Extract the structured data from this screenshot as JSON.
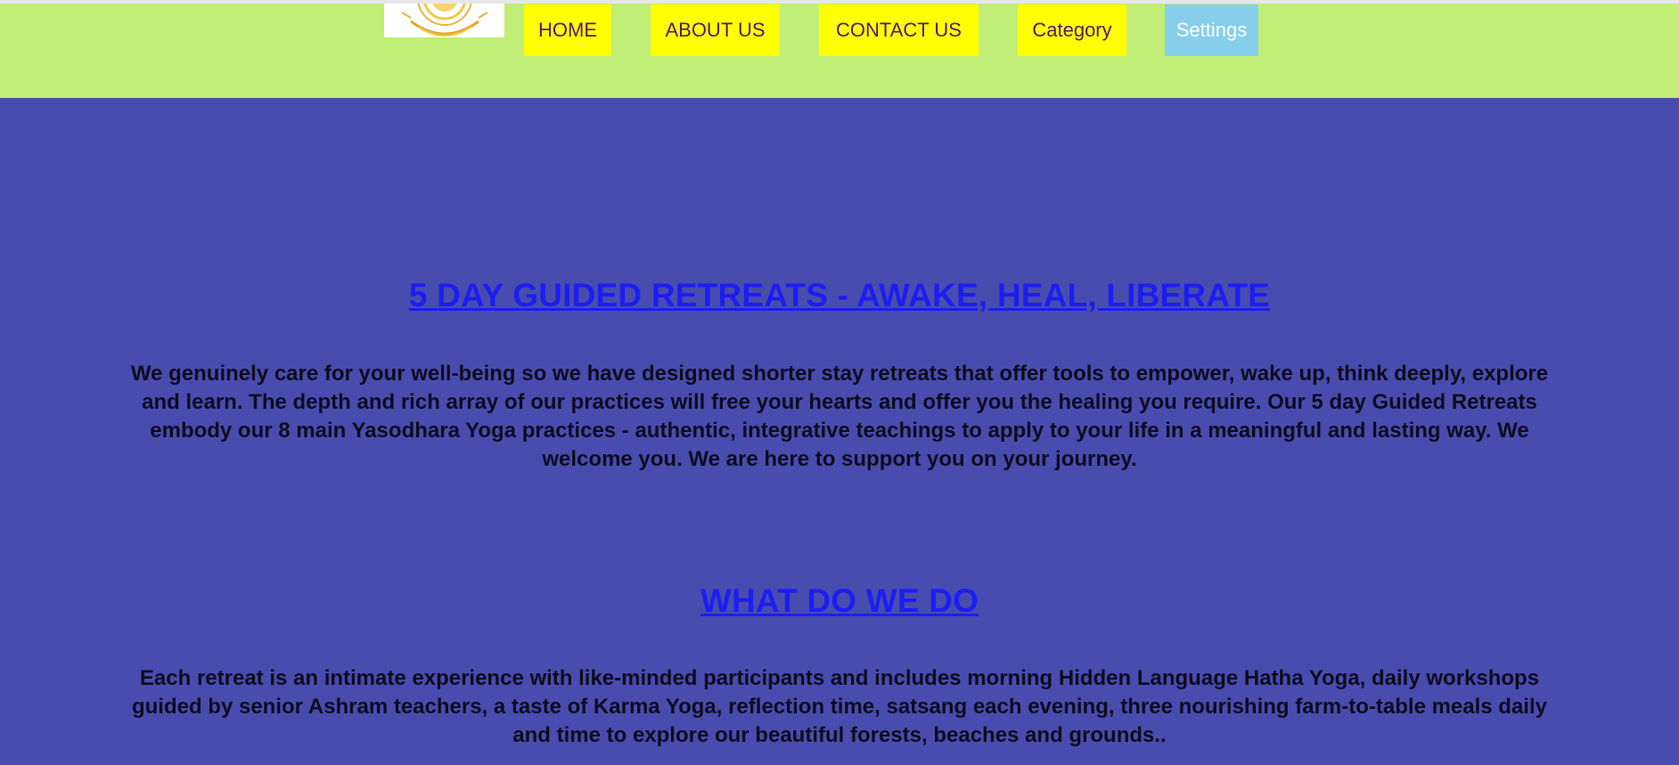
{
  "header": {
    "nav": [
      {
        "label": "HOME"
      },
      {
        "label": "ABOUT US"
      },
      {
        "label": "CONTACT US"
      },
      {
        "label": "Category"
      },
      {
        "label": "Settings"
      }
    ],
    "logo_icon": "sun-logo-icon"
  },
  "sections": [
    {
      "title": "5 DAY GUIDED RETREATS - AWAKE, HEAL, LIBERATE",
      "text": "We genuinely care for your well-being so we have designed shorter stay retreats that offer tools to empower, wake up, think deeply, explore and learn. The depth and rich array of our practices will free your hearts and offer you the healing you require. Our 5 day Guided Retreats embody our 8 main Yasodhara Yoga practices - authentic, integrative teachings to apply to your life in a meaningful and lasting way. We welcome you. We are here to support you on your journey."
    },
    {
      "title": "WHAT DO WE DO",
      "text": "Each retreat is an intimate experience with like-minded participants and includes morning Hidden Language Hatha Yoga, daily workshops guided by senior Ashram teachers, a taste of Karma Yoga, reflection time, satsang each evening, three nourishing farm-to-table meals daily and time to explore our beautiful forests, beaches and grounds.."
    }
  ],
  "colors": {
    "header_bg": "#c1ee76",
    "main_bg": "#484cae",
    "nav_bg": "#ffff00",
    "nav_text": "#5a1473",
    "settings_bg": "#87ceeb",
    "title_color": "#1d1df2",
    "body_text": "#0c0c1e"
  }
}
